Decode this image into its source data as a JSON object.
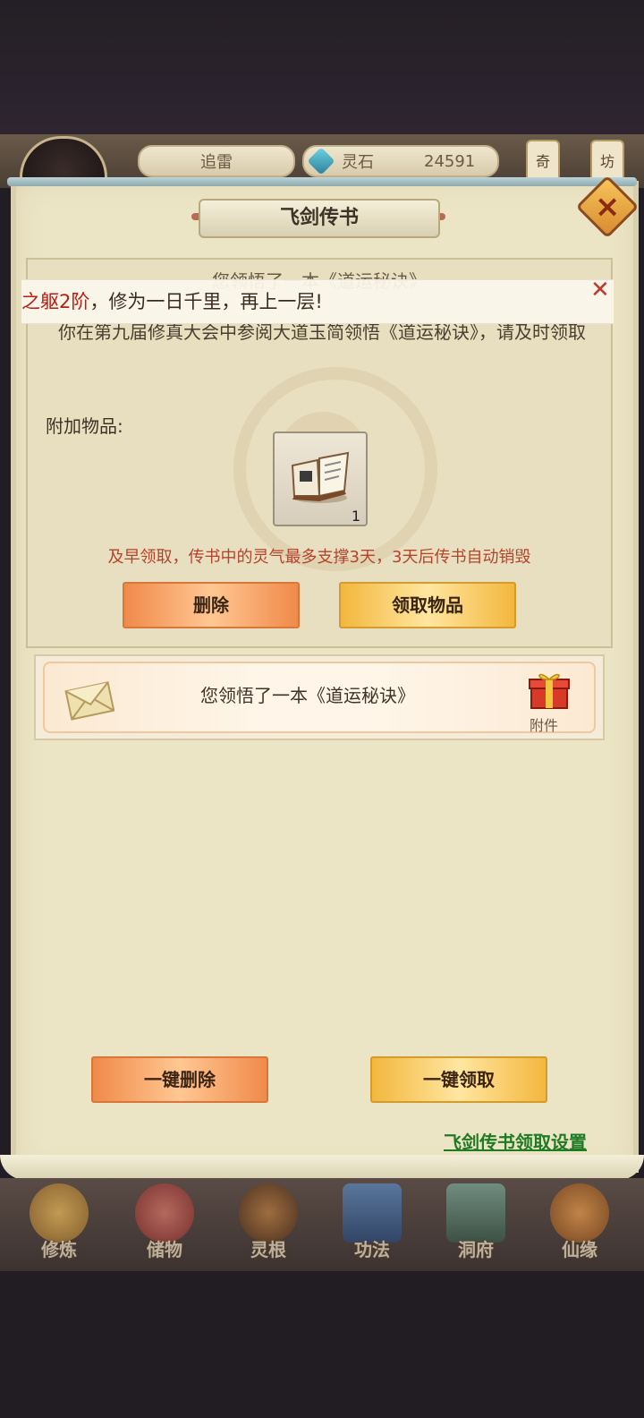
{
  "hud": {
    "name_tab": "追雷",
    "currency_label": "灵石",
    "currency_value": "24591",
    "side_tab_1": "奇",
    "side_tab_2": "坊"
  },
  "dialog": {
    "title": "飞剑传书"
  },
  "notification": {
    "highlight": "之躯2阶",
    "text": "，修为一日千里，再上一层!"
  },
  "message": {
    "title": "您领悟了一本《道运秘诀》",
    "body": "你在第九届修真大会中参阅大道玉简领悟《道运秘诀》，请及时领取",
    "attachment_label": "附加物品:",
    "item_count": "1",
    "warning": "及早领取，传书中的灵气最多支撑3天，3天后传书自动销毁",
    "delete_label": "删除",
    "claim_label": "领取物品"
  },
  "mail_list": [
    {
      "subject": "您领悟了一本《道运秘诀》",
      "attachment_tag": "附件"
    }
  ],
  "actions": {
    "delete_all_label": "一键删除",
    "claim_all_label": "一键领取",
    "settings_link": "飞剑传书领取设置"
  },
  "nav": [
    {
      "label": "修炼",
      "color": "#d49a3a"
    },
    {
      "label": "储物",
      "color": "#c0504a"
    },
    {
      "label": "灵根",
      "color": "#8a5a2a"
    },
    {
      "label": "功法",
      "color": "#3a6a9a"
    },
    {
      "label": "洞府",
      "color": "#5a8a7a"
    },
    {
      "label": "仙缘",
      "color": "#d0803a"
    }
  ],
  "colors": {
    "panel": "#ece5c5",
    "warning": "#b5432c",
    "link": "#1f7a24",
    "highlight": "#b81d14"
  }
}
